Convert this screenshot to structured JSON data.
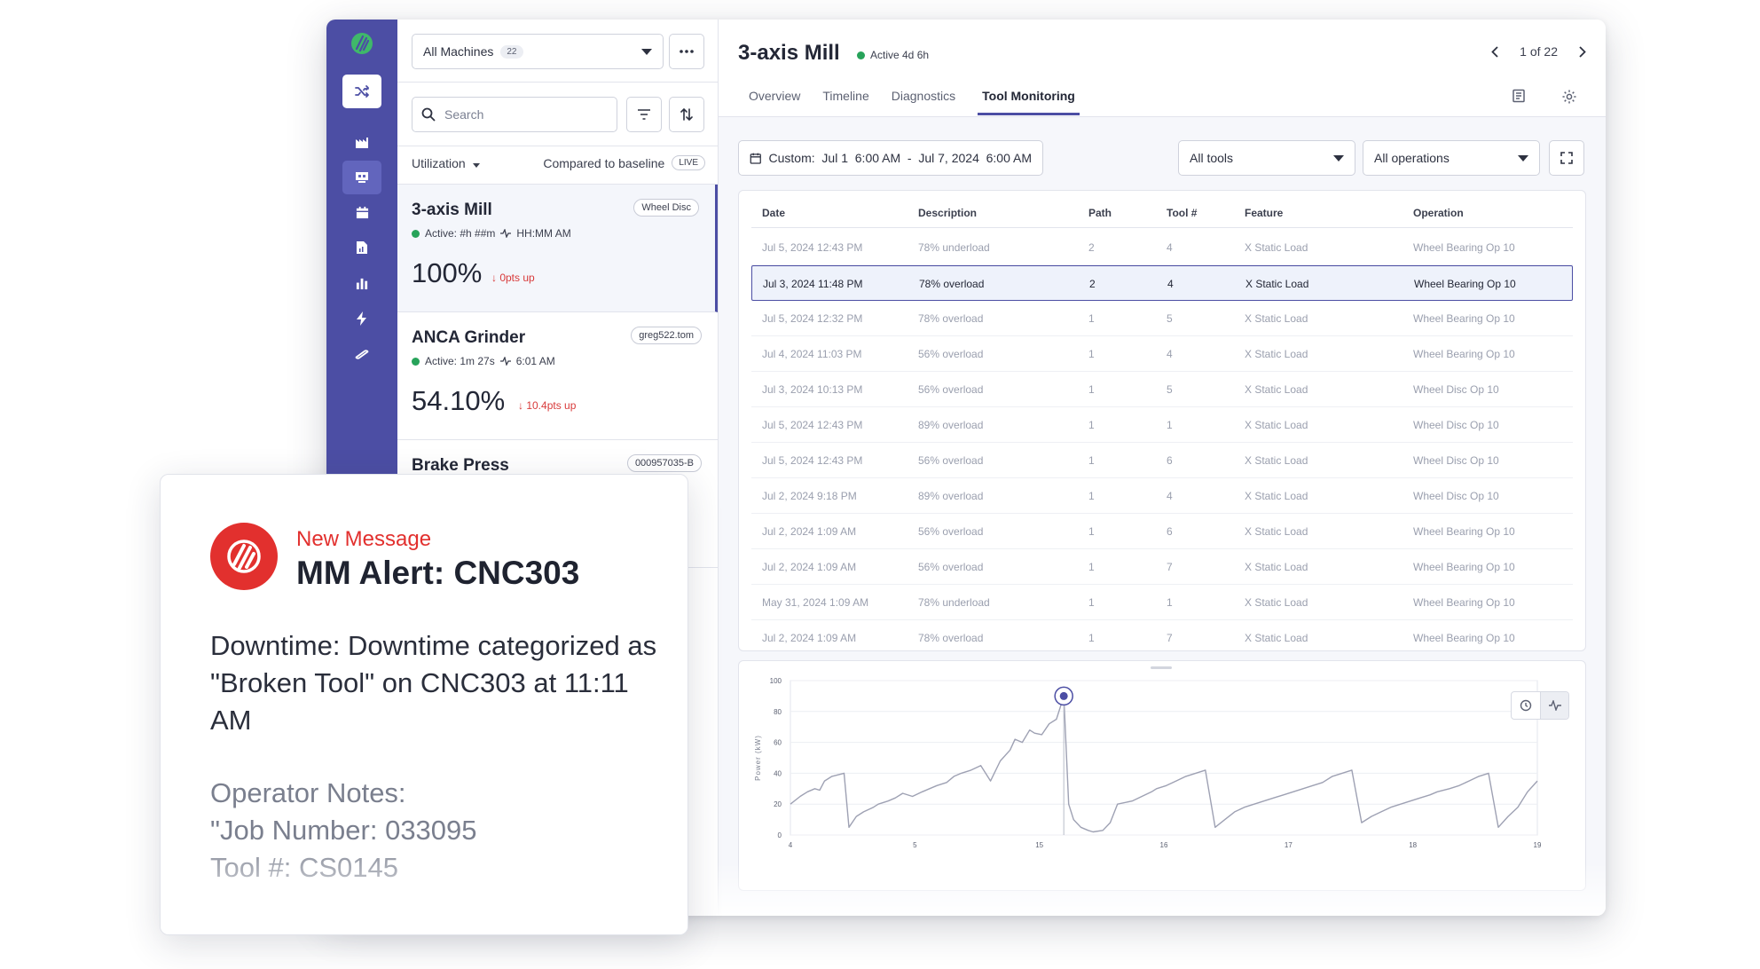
{
  "machines_dropdown": {
    "label": "All Machines",
    "count": "22"
  },
  "search": {
    "placeholder": "Search"
  },
  "util": {
    "label": "Utilization",
    "compare": "Compared to baseline",
    "live": "LIVE"
  },
  "machines": [
    {
      "name": "3-axis Mill",
      "tag": "Wheel Disc",
      "active": "Active: #h ##m",
      "time": "HH:MM AM",
      "pct": "100%",
      "delta": "↓ 0pts up"
    },
    {
      "name": "ANCA Grinder",
      "tag": "greg522.tom",
      "active": "Active: 1m 27s",
      "time": "6:01 AM",
      "pct": "54.10%",
      "delta": "↓ 10.4pts up"
    },
    {
      "name": "Brake Press",
      "tag": "000957035-B"
    }
  ],
  "detail": {
    "title": "3-axis Mill",
    "active": "Active 4d 6h",
    "pager": "1 of 22",
    "tabs": [
      "Overview",
      "Timeline",
      "Diagnostics",
      "Tool Monitoring"
    ]
  },
  "filters": {
    "date": "Custom:  Jul 1  6:00 AM  -  Jul 7, 2024  6:00 AM",
    "tools": "All tools",
    "operations": "All operations"
  },
  "table": {
    "headers": [
      "Date",
      "Description",
      "Path",
      "Tool #",
      "Feature",
      "Operation"
    ],
    "rows": [
      [
        "Jul 5, 2024 12:43 PM",
        "78% underload",
        "2",
        "4",
        "X Static Load",
        "Wheel Bearing Op 10"
      ],
      [
        "Jul 3, 2024 11:48 PM",
        "78% overload",
        "2",
        "4",
        "X Static Load",
        "Wheel Bearing Op 10"
      ],
      [
        "Jul 5, 2024 12:32 PM",
        "78% overload",
        "1",
        "5",
        "X Static Load",
        "Wheel Bearing Op 10"
      ],
      [
        "Jul 4, 2024 11:03 PM",
        "56% overload",
        "1",
        "4",
        "X Static Load",
        "Wheel Bearing Op 10"
      ],
      [
        "Jul 3, 2024 10:13 PM",
        "56% overload",
        "1",
        "5",
        "X Static Load",
        "Wheel Disc Op 10"
      ],
      [
        "Jul 5, 2024 12:43 PM",
        "89% overload",
        "1",
        "1",
        "X Static Load",
        "Wheel Disc Op 10"
      ],
      [
        "Jul 5, 2024 12:43 PM",
        "56% overload",
        "1",
        "6",
        "X Static Load",
        "Wheel Disc Op 10"
      ],
      [
        "Jul 2, 2024 9:18 PM",
        "89% overload",
        "1",
        "4",
        "X Static Load",
        "Wheel Disc Op 10"
      ],
      [
        "Jul 2, 2024 1:09 AM",
        "56% overload",
        "1",
        "6",
        "X Static Load",
        "Wheel Bearing Op 10"
      ],
      [
        "Jul 2, 2024 1:09 AM",
        "56% overload",
        "1",
        "7",
        "X Static Load",
        "Wheel Bearing Op 10"
      ],
      [
        "May 31, 2024 1:09 AM",
        "78% underload",
        "1",
        "1",
        "X Static Load",
        "Wheel Bearing Op 10"
      ],
      [
        "Jul 2, 2024 1:09 AM",
        "78% overload",
        "1",
        "7",
        "X Static Load",
        "Wheel Bearing Op 10"
      ]
    ],
    "selected_row": 1
  },
  "chart_data": {
    "type": "line",
    "ylabel": "Power (kW)",
    "ylim": [
      0,
      100
    ],
    "yticks": [
      "100",
      "80",
      "60",
      "40",
      "20",
      "0"
    ],
    "xlim": [
      4,
      19.3
    ],
    "xticks": [
      "4",
      "5",
      "15",
      "16",
      "17",
      "18",
      "19"
    ],
    "series": [
      {
        "x": [
          4.0,
          4.2,
          4.35,
          4.5,
          4.6,
          4.7,
          4.85,
          5.1,
          5.2,
          5.35,
          5.5,
          5.7,
          5.8,
          6.0,
          6.15,
          6.3,
          6.5,
          6.7,
          6.85,
          7.0,
          7.2,
          7.35,
          7.5,
          7.7,
          7.9,
          8.1,
          8.3,
          8.5,
          8.6,
          8.75,
          8.9,
          9.0,
          9.15,
          9.3,
          9.45,
          9.6,
          9.7,
          9.8,
          9.95,
          10.1,
          10.2,
          10.4,
          10.55,
          10.7,
          11.0,
          11.2,
          11.4,
          11.5,
          11.7,
          11.9,
          12.1,
          12.3,
          12.5,
          12.7,
          12.9,
          13.1,
          13.3,
          13.5,
          13.7,
          13.9,
          14.1,
          14.3,
          14.5,
          14.7,
          14.9,
          15.1,
          15.3,
          15.5,
          15.7,
          15.9,
          16.1,
          16.3,
          16.5,
          16.7,
          16.9,
          17.1,
          17.25,
          17.5,
          17.7,
          17.9,
          18.1,
          18.3,
          18.5,
          18.7,
          18.9,
          19.1,
          19.3
        ],
        "y": [
          20,
          25,
          28,
          30,
          29,
          35,
          38,
          40,
          5,
          12,
          15,
          18,
          20,
          22,
          24,
          27,
          25,
          28,
          30,
          32,
          34,
          38,
          40,
          42,
          45,
          35,
          48,
          55,
          62,
          60,
          68,
          66,
          65,
          72,
          75,
          90,
          20,
          10,
          5,
          3,
          2,
          3,
          8,
          20,
          22,
          25,
          28,
          30,
          32,
          35,
          38,
          40,
          42,
          5,
          10,
          15,
          18,
          20,
          22,
          24,
          26,
          28,
          30,
          32,
          34,
          38,
          40,
          42,
          8,
          12,
          15,
          18,
          20,
          22,
          24,
          26,
          28,
          30,
          32,
          35,
          38,
          40,
          5,
          12,
          18,
          28,
          35
        ],
        "marker": {
          "x": 9.6,
          "y": 90
        }
      }
    ]
  },
  "notification": {
    "label": "New Message",
    "title": "MM Alert: CNC303",
    "body": "Downtime: Downtime categorized as \"Broken Tool\" on CNC303 at 11:11 AM",
    "notes_line1": "Operator Notes:",
    "notes_line2": "\"Job Number: 033095",
    "notes_line3": "Tool #: CS0145"
  },
  "colors": {
    "accent": "#4c4ea4",
    "alert": "#e2302e",
    "active": "#27a35a",
    "delta": "#d83a3a"
  }
}
